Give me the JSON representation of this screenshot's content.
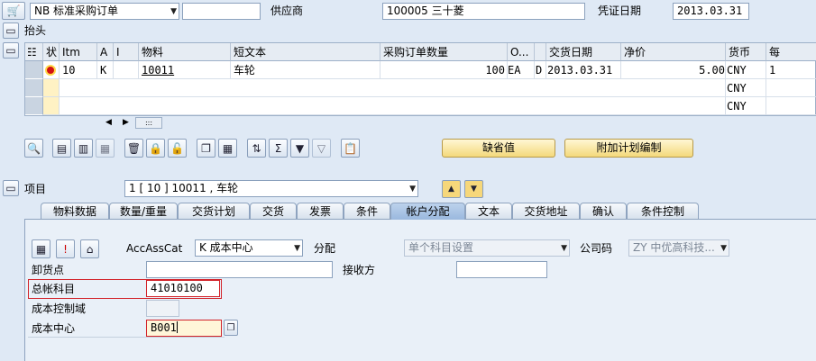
{
  "header": {
    "doc_type": "NB 标准采购订单",
    "vendor_label": "供应商",
    "vendor_value": "100005 三十菱",
    "date_label": "凭证日期",
    "date_value": "2013.03.31",
    "header_label": "抬头"
  },
  "grid": {
    "columns": [
      "Itm",
      "A",
      "I",
      "物料",
      "短文本",
      "采购订单数量",
      "O...",
      "交货日期",
      "净价",
      "货币",
      "每"
    ],
    "rows": [
      {
        "itm": "10",
        "a": "K",
        "i": "",
        "material": "10011",
        "short_text": "车轮",
        "qty": "100",
        "unit": "EA",
        "d": "D",
        "delivery_date": "2013.03.31",
        "net_price": "5.00",
        "currency": "CNY",
        "per": "1"
      },
      {
        "currency": "CNY"
      },
      {
        "currency": "CNY"
      }
    ]
  },
  "buttons": {
    "default_values": "缺省值",
    "additional_planning": "附加计划编制"
  },
  "item": {
    "label": "项目",
    "selected": "1 [ 10 ] 10011 , 车轮"
  },
  "tabs": [
    "物料数据",
    "数量/重量",
    "交货计划",
    "交货",
    "发票",
    "条件",
    "帐户分配",
    "文本",
    "交货地址",
    "确认",
    "条件控制"
  ],
  "account": {
    "acc_ass_cat_label": "AccAssCat",
    "acc_ass_cat_value": "K 成本中心",
    "distribution_label": "分配",
    "distribution_value": "单个科目设置",
    "company_code_label": "公司码",
    "company_code_value": "ZY 中优高科技...",
    "unloading_point_label": "卸货点",
    "recipient_label": "接收方",
    "gl_account_label": "总帐科目",
    "gl_account_value": "41010100",
    "co_area_label": "成本控制域",
    "cost_center_label": "成本中心",
    "cost_center_value": "B001"
  }
}
